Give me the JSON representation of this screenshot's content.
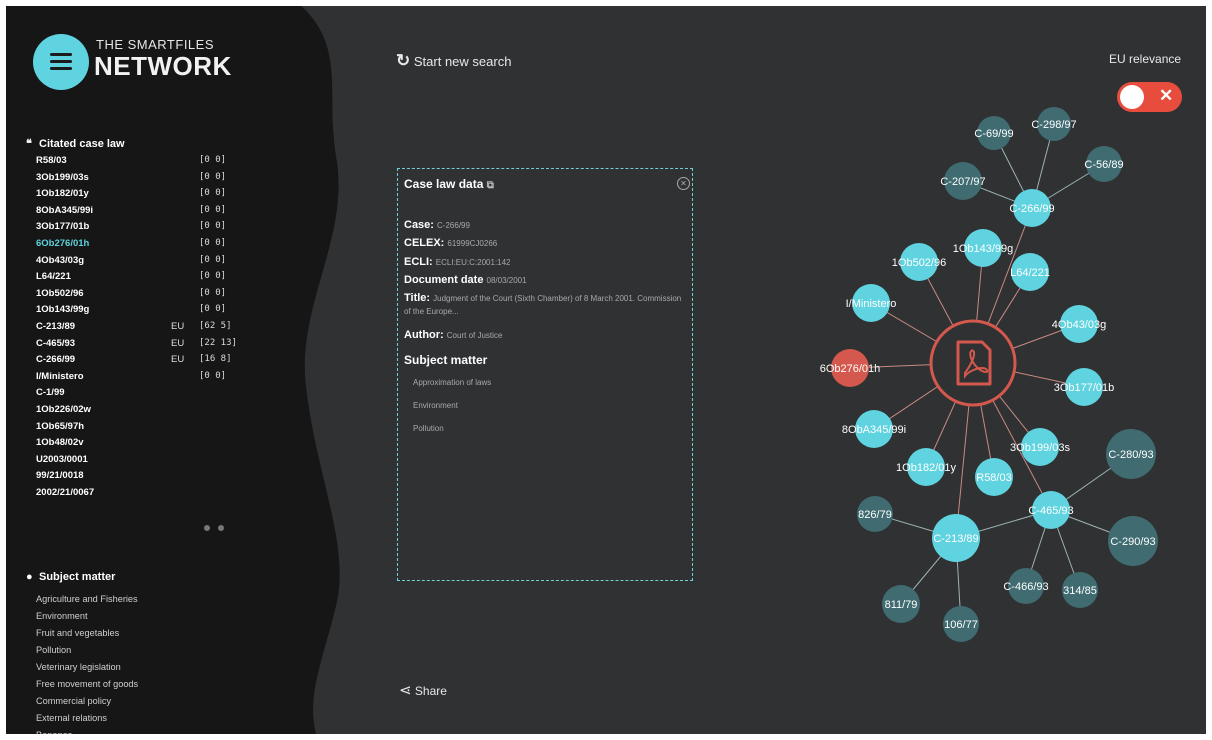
{
  "brand": {
    "line1": "THE SMARTFILES",
    "line2": "NETWORK"
  },
  "sidebar": {
    "cited_title": "Citated case law",
    "cases": [
      {
        "name": "R58/03",
        "eu": "",
        "count": "[0  0]"
      },
      {
        "name": "3Ob199/03s",
        "eu": "",
        "count": "[0  0]"
      },
      {
        "name": "1Ob182/01y",
        "eu": "",
        "count": "[0  0]"
      },
      {
        "name": "8ObA345/99i",
        "eu": "",
        "count": "[0  0]"
      },
      {
        "name": "3Ob177/01b",
        "eu": "",
        "count": "[0  0]"
      },
      {
        "name": "6Ob276/01h",
        "eu": "",
        "count": "[0  0]",
        "active": true
      },
      {
        "name": "4Ob43/03g",
        "eu": "",
        "count": "[0  0]"
      },
      {
        "name": "L64/221",
        "eu": "",
        "count": "[0  0]"
      },
      {
        "name": "1Ob502/96",
        "eu": "",
        "count": "[0  0]"
      },
      {
        "name": "1Ob143/99g",
        "eu": "",
        "count": "[0  0]"
      },
      {
        "name": "C-213/89",
        "eu": "EU",
        "count": "[62  5]"
      },
      {
        "name": "C-465/93",
        "eu": "EU",
        "count": "[22 13]"
      },
      {
        "name": "C-266/99",
        "eu": "EU",
        "count": "[16  8]"
      },
      {
        "name": "I/Ministero",
        "eu": "",
        "count": "[0  0]"
      },
      {
        "name": "C-1/99",
        "eu": "",
        "count": ""
      },
      {
        "name": "1Ob226/02w",
        "eu": "",
        "count": ""
      },
      {
        "name": "1Ob65/97h",
        "eu": "",
        "count": ""
      },
      {
        "name": "1Ob48/02v",
        "eu": "",
        "count": ""
      },
      {
        "name": "U2003/0001",
        "eu": "",
        "count": ""
      },
      {
        "name": "99/21/0018",
        "eu": "",
        "count": ""
      },
      {
        "name": "2002/21/0067",
        "eu": "",
        "count": ""
      }
    ],
    "subject_title": "Subject matter",
    "subjects": [
      "Agriculture and Fisheries",
      "Environment",
      "Fruit and vegetables",
      "Pollution",
      "Veterinary legislation",
      "Free movement of goods",
      "Commercial policy",
      "External relations",
      "Bananas"
    ]
  },
  "header": {
    "start_new_search": "Start new search",
    "eu_relevance_label": "EU relevance"
  },
  "card": {
    "title": "Case law data",
    "case_label": "Case:",
    "case_value": "C-266/99",
    "celex_label": "CELEX:",
    "celex_value": "61999CJ0266",
    "ecli_label": "ECLI:",
    "ecli_value": "ECLI:EU:C:2001:142",
    "date_label": "Document date",
    "date_value": "08/03/2001",
    "title_label": "Title:",
    "title_value": "Judgment of the Court (Sixth Chamber) of 8 March 2001. Commission of the Europe...",
    "author_label": "Author:",
    "author_value": "Court of Justice",
    "subject_head": "Subject matter",
    "subjects": [
      "Approximation of laws",
      "Environment",
      "Pollution"
    ]
  },
  "share_label": "Share",
  "colors": {
    "background": "#2f3133",
    "sidebar": "#161616",
    "accent": "#5fd3df",
    "node_muted": "#3f6b71",
    "highlight": "#d4584d"
  },
  "graph": {
    "center_icon": "pdf-document-icon",
    "nodes": [
      {
        "label": "C-69/99",
        "tone": "muted"
      },
      {
        "label": "C-298/97",
        "tone": "muted"
      },
      {
        "label": "C-56/89",
        "tone": "muted"
      },
      {
        "label": "C-207/97",
        "tone": "muted"
      },
      {
        "label": "C-266/99",
        "tone": "bright"
      },
      {
        "label": "1Ob143/99g",
        "tone": "bright"
      },
      {
        "label": "1Ob502/96",
        "tone": "bright"
      },
      {
        "label": "L64/221",
        "tone": "bright"
      },
      {
        "label": "I/Ministero",
        "tone": "bright"
      },
      {
        "label": "4Ob43/03g",
        "tone": "bright"
      },
      {
        "label": "6Ob276/01h",
        "tone": "red"
      },
      {
        "label": "3Ob177/01b",
        "tone": "bright"
      },
      {
        "label": "8ObA345/99i",
        "tone": "bright"
      },
      {
        "label": "3Ob199/03s",
        "tone": "bright"
      },
      {
        "label": "C-280/93",
        "tone": "muted"
      },
      {
        "label": "1Ob182/01y",
        "tone": "bright"
      },
      {
        "label": "R58/03",
        "tone": "bright"
      },
      {
        "label": "C-465/93",
        "tone": "bright"
      },
      {
        "label": "826/79",
        "tone": "muted"
      },
      {
        "label": "C-213/89",
        "tone": "bright"
      },
      {
        "label": "C-290/93",
        "tone": "muted"
      },
      {
        "label": "C-466/93",
        "tone": "muted"
      },
      {
        "label": "314/85",
        "tone": "muted"
      },
      {
        "label": "811/79",
        "tone": "muted"
      },
      {
        "label": "106/77",
        "tone": "muted"
      }
    ]
  }
}
